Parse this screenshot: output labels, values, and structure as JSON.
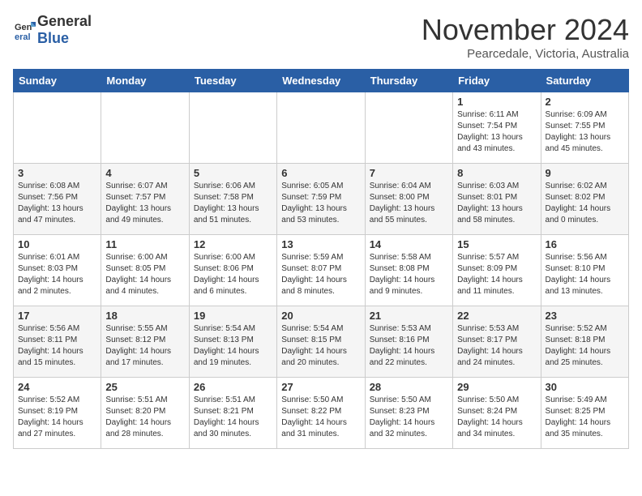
{
  "header": {
    "logo_general": "General",
    "logo_blue": "Blue",
    "month_title": "November 2024",
    "location": "Pearcedale, Victoria, Australia"
  },
  "weekdays": [
    "Sunday",
    "Monday",
    "Tuesday",
    "Wednesday",
    "Thursday",
    "Friday",
    "Saturday"
  ],
  "weeks": [
    [
      {
        "day": "",
        "info": ""
      },
      {
        "day": "",
        "info": ""
      },
      {
        "day": "",
        "info": ""
      },
      {
        "day": "",
        "info": ""
      },
      {
        "day": "",
        "info": ""
      },
      {
        "day": "1",
        "info": "Sunrise: 6:11 AM\nSunset: 7:54 PM\nDaylight: 13 hours\nand 43 minutes."
      },
      {
        "day": "2",
        "info": "Sunrise: 6:09 AM\nSunset: 7:55 PM\nDaylight: 13 hours\nand 45 minutes."
      }
    ],
    [
      {
        "day": "3",
        "info": "Sunrise: 6:08 AM\nSunset: 7:56 PM\nDaylight: 13 hours\nand 47 minutes."
      },
      {
        "day": "4",
        "info": "Sunrise: 6:07 AM\nSunset: 7:57 PM\nDaylight: 13 hours\nand 49 minutes."
      },
      {
        "day": "5",
        "info": "Sunrise: 6:06 AM\nSunset: 7:58 PM\nDaylight: 13 hours\nand 51 minutes."
      },
      {
        "day": "6",
        "info": "Sunrise: 6:05 AM\nSunset: 7:59 PM\nDaylight: 13 hours\nand 53 minutes."
      },
      {
        "day": "7",
        "info": "Sunrise: 6:04 AM\nSunset: 8:00 PM\nDaylight: 13 hours\nand 55 minutes."
      },
      {
        "day": "8",
        "info": "Sunrise: 6:03 AM\nSunset: 8:01 PM\nDaylight: 13 hours\nand 58 minutes."
      },
      {
        "day": "9",
        "info": "Sunrise: 6:02 AM\nSunset: 8:02 PM\nDaylight: 14 hours\nand 0 minutes."
      }
    ],
    [
      {
        "day": "10",
        "info": "Sunrise: 6:01 AM\nSunset: 8:03 PM\nDaylight: 14 hours\nand 2 minutes."
      },
      {
        "day": "11",
        "info": "Sunrise: 6:00 AM\nSunset: 8:05 PM\nDaylight: 14 hours\nand 4 minutes."
      },
      {
        "day": "12",
        "info": "Sunrise: 6:00 AM\nSunset: 8:06 PM\nDaylight: 14 hours\nand 6 minutes."
      },
      {
        "day": "13",
        "info": "Sunrise: 5:59 AM\nSunset: 8:07 PM\nDaylight: 14 hours\nand 8 minutes."
      },
      {
        "day": "14",
        "info": "Sunrise: 5:58 AM\nSunset: 8:08 PM\nDaylight: 14 hours\nand 9 minutes."
      },
      {
        "day": "15",
        "info": "Sunrise: 5:57 AM\nSunset: 8:09 PM\nDaylight: 14 hours\nand 11 minutes."
      },
      {
        "day": "16",
        "info": "Sunrise: 5:56 AM\nSunset: 8:10 PM\nDaylight: 14 hours\nand 13 minutes."
      }
    ],
    [
      {
        "day": "17",
        "info": "Sunrise: 5:56 AM\nSunset: 8:11 PM\nDaylight: 14 hours\nand 15 minutes."
      },
      {
        "day": "18",
        "info": "Sunrise: 5:55 AM\nSunset: 8:12 PM\nDaylight: 14 hours\nand 17 minutes."
      },
      {
        "day": "19",
        "info": "Sunrise: 5:54 AM\nSunset: 8:13 PM\nDaylight: 14 hours\nand 19 minutes."
      },
      {
        "day": "20",
        "info": "Sunrise: 5:54 AM\nSunset: 8:15 PM\nDaylight: 14 hours\nand 20 minutes."
      },
      {
        "day": "21",
        "info": "Sunrise: 5:53 AM\nSunset: 8:16 PM\nDaylight: 14 hours\nand 22 minutes."
      },
      {
        "day": "22",
        "info": "Sunrise: 5:53 AM\nSunset: 8:17 PM\nDaylight: 14 hours\nand 24 minutes."
      },
      {
        "day": "23",
        "info": "Sunrise: 5:52 AM\nSunset: 8:18 PM\nDaylight: 14 hours\nand 25 minutes."
      }
    ],
    [
      {
        "day": "24",
        "info": "Sunrise: 5:52 AM\nSunset: 8:19 PM\nDaylight: 14 hours\nand 27 minutes."
      },
      {
        "day": "25",
        "info": "Sunrise: 5:51 AM\nSunset: 8:20 PM\nDaylight: 14 hours\nand 28 minutes."
      },
      {
        "day": "26",
        "info": "Sunrise: 5:51 AM\nSunset: 8:21 PM\nDaylight: 14 hours\nand 30 minutes."
      },
      {
        "day": "27",
        "info": "Sunrise: 5:50 AM\nSunset: 8:22 PM\nDaylight: 14 hours\nand 31 minutes."
      },
      {
        "day": "28",
        "info": "Sunrise: 5:50 AM\nSunset: 8:23 PM\nDaylight: 14 hours\nand 32 minutes."
      },
      {
        "day": "29",
        "info": "Sunrise: 5:50 AM\nSunset: 8:24 PM\nDaylight: 14 hours\nand 34 minutes."
      },
      {
        "day": "30",
        "info": "Sunrise: 5:49 AM\nSunset: 8:25 PM\nDaylight: 14 hours\nand 35 minutes."
      }
    ]
  ]
}
